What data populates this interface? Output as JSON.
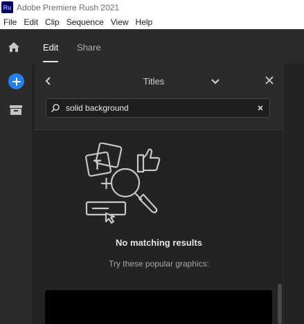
{
  "window": {
    "logo": "Ru",
    "title": "Adobe Premiere Rush 2021"
  },
  "menu": [
    "File",
    "Edit",
    "Clip",
    "Sequence",
    "View",
    "Help"
  ],
  "top_tabs": {
    "edit": "Edit",
    "share": "Share",
    "active": "Edit"
  },
  "panel": {
    "title": "Titles",
    "search_value": "solid background",
    "empty_title": "No matching results",
    "empty_subtitle": "Try these popular graphics:"
  },
  "icons": {
    "home": "home-icon",
    "add": "plus-icon",
    "media": "media-box-icon",
    "back": "chevron-left-icon",
    "dropdown": "chevron-down-icon",
    "close": "close-icon",
    "search": "search-icon",
    "clear": "clear-icon",
    "empty": "no-results-illustration"
  },
  "colors": {
    "accent": "#2680eb",
    "panel_bg": "#232323",
    "toolbar_bg": "#2b2b2b"
  }
}
